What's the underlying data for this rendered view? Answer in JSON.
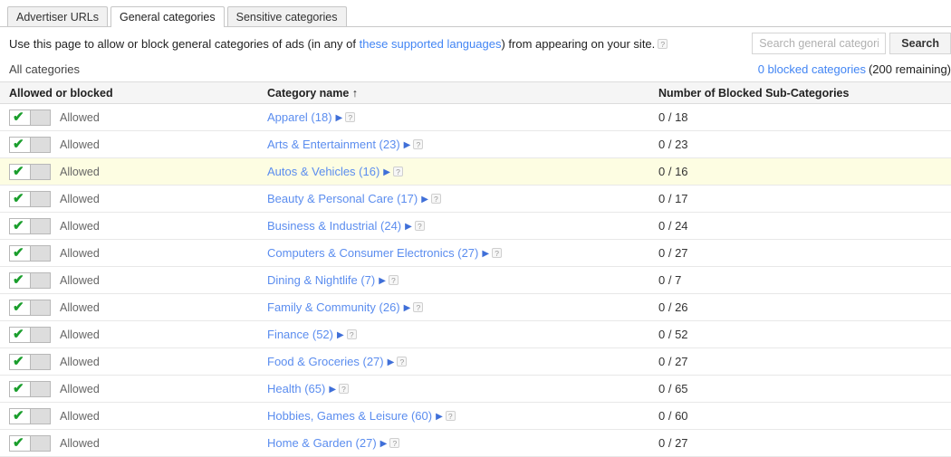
{
  "tabs": [
    {
      "label": "Advertiser URLs",
      "active": false
    },
    {
      "label": "General categories",
      "active": true
    },
    {
      "label": "Sensitive categories",
      "active": false
    }
  ],
  "description": {
    "before_link": "Use this page to allow or block general categories of ads (in any of ",
    "link_text": "these supported languages",
    "after_link": ") from appearing on your site.",
    "help_glyph": "?"
  },
  "search": {
    "placeholder": "Search general categories",
    "value": "",
    "button_label": "Search"
  },
  "summary": {
    "all_categories_label": "All categories",
    "blocked_link": "0 blocked categories",
    "remaining": "(200 remaining)"
  },
  "table": {
    "headers": {
      "allowed_or_blocked": "Allowed or blocked",
      "category_name": "Category name ↑",
      "blocked_subcategories": "Number of Blocked Sub-Categories"
    },
    "state_label": "Allowed",
    "help_glyph": "?",
    "caret_glyph": "▶",
    "check_glyph": "✔",
    "rows": [
      {
        "state": "Allowed",
        "category": "Apparel (18)",
        "blocked": "0 / 18",
        "highlight": false
      },
      {
        "state": "Allowed",
        "category": "Arts & Entertainment (23)",
        "blocked": "0 / 23",
        "highlight": false
      },
      {
        "state": "Allowed",
        "category": "Autos & Vehicles (16)",
        "blocked": "0 / 16",
        "highlight": true
      },
      {
        "state": "Allowed",
        "category": "Beauty & Personal Care (17)",
        "blocked": "0 / 17",
        "highlight": false
      },
      {
        "state": "Allowed",
        "category": "Business & Industrial (24)",
        "blocked": "0 / 24",
        "highlight": false
      },
      {
        "state": "Allowed",
        "category": "Computers & Consumer Electronics (27)",
        "blocked": "0 / 27",
        "highlight": false
      },
      {
        "state": "Allowed",
        "category": "Dining & Nightlife (7)",
        "blocked": "0 / 7",
        "highlight": false
      },
      {
        "state": "Allowed",
        "category": "Family & Community (26)",
        "blocked": "0 / 26",
        "highlight": false
      },
      {
        "state": "Allowed",
        "category": "Finance (52)",
        "blocked": "0 / 52",
        "highlight": false
      },
      {
        "state": "Allowed",
        "category": "Food & Groceries (27)",
        "blocked": "0 / 27",
        "highlight": false
      },
      {
        "state": "Allowed",
        "category": "Health (65)",
        "blocked": "0 / 65",
        "highlight": false
      },
      {
        "state": "Allowed",
        "category": "Hobbies, Games & Leisure (60)",
        "blocked": "0 / 60",
        "highlight": false
      },
      {
        "state": "Allowed",
        "category": "Home & Garden (27)",
        "blocked": "0 / 27",
        "highlight": false
      }
    ]
  },
  "colors": {
    "link": "#4285f4",
    "category_link": "#5b8def",
    "check_green": "#1a9e2c",
    "header_bg": "#f5f5f5",
    "highlight_row": "#fdfde2"
  }
}
